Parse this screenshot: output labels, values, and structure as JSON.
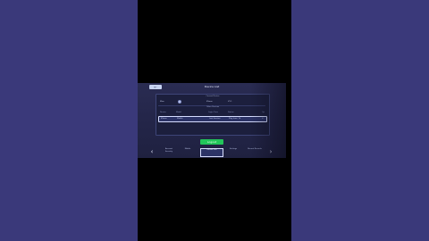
{
  "screen": {
    "title": "Device List",
    "back_label": "←",
    "sections": {
      "current_device": "Current Device",
      "other_devices": "Other Devices"
    },
    "current_device": {
      "label": "Mine",
      "model": "iPhone",
      "status": "V1.1"
    },
    "table": {
      "headers": [
        "Device",
        "Model",
        "Login Time",
        "Status",
        "Op"
      ],
      "rows": [
        [
          "iPhone",
          "Mobile",
          "Last Session",
          "Play time: 1h",
          "✕"
        ]
      ]
    },
    "confirm_label": "Logout",
    "tabs": [
      "Account Security",
      "Mobile",
      "Device List",
      "Settings",
      "Recent Records"
    ],
    "active_tab": 2,
    "nav": {
      "prev": "‹",
      "next": "›"
    }
  },
  "colors": {
    "side_background": "#3a397a",
    "accent_green": "#22c55a",
    "selected_border": "#d6ddff"
  }
}
